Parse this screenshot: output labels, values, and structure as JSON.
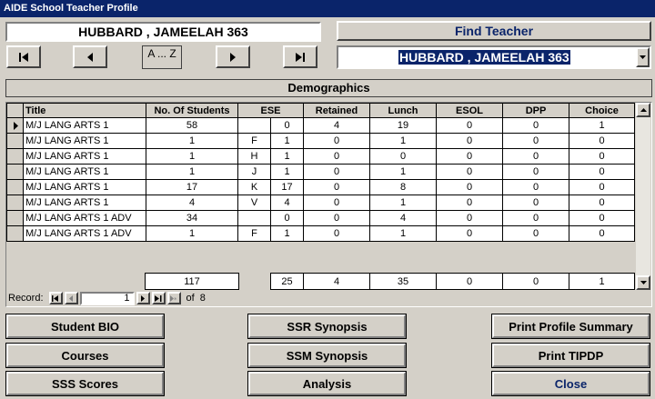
{
  "window": {
    "title": "AIDE School Teacher Profile"
  },
  "teacher": {
    "name": "HUBBARD , JAMEELAH 363"
  },
  "find": {
    "label": "Find Teacher",
    "selected": "HUBBARD , JAMEELAH 363"
  },
  "nav": {
    "az_label": "A ... Z"
  },
  "section": {
    "title": "Demographics"
  },
  "grid": {
    "columns": [
      "Title",
      "No. Of Students",
      "ESE",
      "Retained",
      "Lunch",
      "ESOL",
      "DPP",
      "Choice"
    ],
    "rows": [
      {
        "title": "M/J LANG ARTS 1",
        "students": "58",
        "ese_code": "",
        "ese": "0",
        "retained": "4",
        "lunch": "19",
        "esol": "0",
        "dpp": "0",
        "choice": "1"
      },
      {
        "title": "M/J LANG ARTS 1",
        "students": "1",
        "ese_code": "F",
        "ese": "1",
        "retained": "0",
        "lunch": "1",
        "esol": "0",
        "dpp": "0",
        "choice": "0"
      },
      {
        "title": "M/J LANG ARTS 1",
        "students": "1",
        "ese_code": "H",
        "ese": "1",
        "retained": "0",
        "lunch": "0",
        "esol": "0",
        "dpp": "0",
        "choice": "0"
      },
      {
        "title": "M/J LANG ARTS 1",
        "students": "1",
        "ese_code": "J",
        "ese": "1",
        "retained": "0",
        "lunch": "1",
        "esol": "0",
        "dpp": "0",
        "choice": "0"
      },
      {
        "title": "M/J LANG ARTS 1",
        "students": "17",
        "ese_code": "K",
        "ese": "17",
        "retained": "0",
        "lunch": "8",
        "esol": "0",
        "dpp": "0",
        "choice": "0"
      },
      {
        "title": "M/J LANG ARTS 1",
        "students": "4",
        "ese_code": "V",
        "ese": "4",
        "retained": "0",
        "lunch": "1",
        "esol": "0",
        "dpp": "0",
        "choice": "0"
      },
      {
        "title": "M/J LANG ARTS 1 ADV",
        "students": "34",
        "ese_code": "",
        "ese": "0",
        "retained": "0",
        "lunch": "4",
        "esol": "0",
        "dpp": "0",
        "choice": "0"
      },
      {
        "title": "M/J LANG ARTS 1 ADV",
        "students": "1",
        "ese_code": "F",
        "ese": "1",
        "retained": "0",
        "lunch": "1",
        "esol": "0",
        "dpp": "0",
        "choice": "0"
      }
    ],
    "totals": {
      "students": "117",
      "ese": "25",
      "retained": "4",
      "lunch": "35",
      "esol": "0",
      "dpp": "0",
      "choice": "1"
    }
  },
  "record": {
    "label": "Record:",
    "current": "1",
    "of_label": "of",
    "total": "8"
  },
  "buttons": {
    "student_bio": "Student BIO",
    "courses": "Courses",
    "sss_scores": "SSS Scores",
    "ssr_synopsis": "SSR Synopsis",
    "ssm_synopsis": "SSM Synopsis",
    "analysis": "Analysis",
    "print_profile": "Print Profile Summary",
    "print_tipdp": "Print TIPDP",
    "close": "Close"
  },
  "colors": {
    "titlebar": "#0a246a",
    "face": "#d4d0c8",
    "accent": "#0a246a"
  }
}
